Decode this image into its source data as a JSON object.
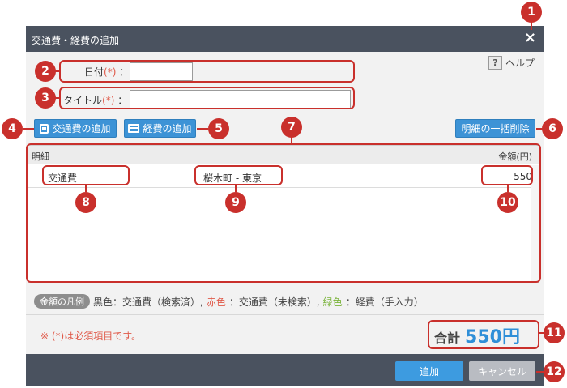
{
  "dialog": {
    "title": "交通費・経費の追加",
    "close_icon": "×",
    "help": {
      "icon": "?",
      "label": "ヘルプ"
    }
  },
  "form": {
    "date_label": "日付",
    "date_required": "(*)",
    "date_colon": "：",
    "date_value": "",
    "title_label": "タイトル",
    "title_required": "(*)",
    "title_colon": "：",
    "title_value": ""
  },
  "toolbar": {
    "add_transport": "交通費の追加",
    "add_expense": "経費の追加",
    "bulk_delete": "明細の一括削除"
  },
  "table": {
    "headers": [
      "明細",
      "金額(円)"
    ],
    "rows": [
      {
        "type": "交通費",
        "route": "桜木町 - 東京",
        "amount": "550"
      }
    ]
  },
  "legend": {
    "tag": "金額の凡例",
    "black": "黒色：交通費（検索済）,",
    "red": "赤色",
    "red_desc": "：交通費（未検索）,",
    "green": "緑色",
    "green_desc": "：経費（手入力）"
  },
  "note": "※ (*)は必須項目です。",
  "total": {
    "label": "合計",
    "value": "550円"
  },
  "footer": {
    "add": "追加",
    "cancel": "キャンセル"
  },
  "callouts": [
    "1",
    "2",
    "3",
    "4",
    "5",
    "6",
    "7",
    "8",
    "9",
    "10",
    "11",
    "12"
  ],
  "colors": {
    "titlebar": "#4a525f",
    "accent": "#3d93d6",
    "callout": "#c9302c",
    "required": "#e05a4a",
    "expense_green": "#7ab33b"
  }
}
